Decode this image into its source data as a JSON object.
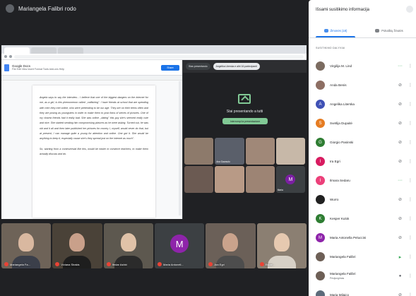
{
  "meeting": {
    "presenter_name": "Mariangela Falibri rodo"
  },
  "share": {
    "doc_title": "Google Docs",
    "doc_menu": "File  Edit  View  Insert  Format  Tools  Add-ons  Help",
    "share_label": "Share",
    "doc_paragraph_1": "Angela says to say the interview... I believe that one of the biggest dangers on the internet for me, as a girl, is this phenomenon called ,,catfishing\". I have friends at school that are spending with men they met online, who were pretending to be our age. They are on their teens often and they are posing as youngsters in order to make them to post fotos of selves of pictures. One of my closest friends had it really bad. She was online ,,dating\" this guy she's seemed really cute and nice. She started sending him compromising pictures as he were asking. Turned out, he was old and it all and then later published her pictures for money. I, myself, would never do that, but at present, I can manage quite a young for attention and online. One got it. She would be anything to keep it, especially cause she's they spread just on the internet as much\".",
    "doc_paragraph_2": "So, starting from a controversial like this, would be easier to convince teachers, to make them actually discuss and do.",
    "meet_chip_1": "Stas presentando",
    "meet_chip_2": "Angelika Literska e altri 16 partecipanti",
    "present_title": "Stai presentando a tutti",
    "present_button": "Interrompi la presentazione",
    "mini_tiles": [
      {
        "label": "",
        "bg": "#8d7a6b",
        "avatar": ""
      },
      {
        "label": "Ana Gaarsolo",
        "bg": "#5a5f6a",
        "avatar": ""
      },
      {
        "label": "",
        "bg": "#a08878",
        "avatar": ""
      },
      {
        "label": "",
        "bg": "#c7b8a8",
        "avatar": ""
      },
      {
        "label": "",
        "bg": "#6b5a52",
        "avatar": ""
      },
      {
        "label": "",
        "bg": "#b89a86",
        "avatar": ""
      },
      {
        "label": "",
        "bg": "#9d8474",
        "avatar": ""
      },
      {
        "label": "Maria",
        "bg": "#3c4043",
        "avatar": "M"
      }
    ]
  },
  "tiles": [
    {
      "name": "Mariangela Fa...",
      "bg": "#6e6358",
      "face": "#d9b8a0",
      "body": "#3b3f4a",
      "avatar": ""
    },
    {
      "name": "Viviana Sirakis",
      "bg": "#4a4238",
      "face": "#c9a08a",
      "body": "#1e1e1e",
      "avatar": ""
    },
    {
      "name": "Ifedar Ashbi",
      "bg": "#5d584f",
      "face": "#e0c2a8",
      "body": "#2b2b2b",
      "avatar": ""
    },
    {
      "name": "Maria Antonell...",
      "bg": "#3c4043",
      "face": "",
      "body": "",
      "avatar": "M"
    },
    {
      "name": "Ara Egri",
      "bg": "#6b6058",
      "face": "#caa38c",
      "body": "#4d4d4d",
      "avatar": ""
    },
    {
      "name": "Eskar...",
      "bg": "#8b7f72",
      "face": "#e6c9b0",
      "body": "#d7d0c6",
      "avatar": ""
    }
  ],
  "panel": {
    "title": "Išsami susitikimo informacija",
    "tab_people": "Žmonės (18)",
    "tab_chat": "Pokalbių žinutės",
    "section": "SUSITIKIMO DALYVIAI",
    "people": [
      {
        "name": "Virgilija M. Lind",
        "sub": "",
        "color": "#7b6b60",
        "initial": "",
        "icon": "dots"
      },
      {
        "name": "Anda Benis",
        "sub": "",
        "color": "#8d6e63",
        "initial": "",
        "icon": "mic"
      },
      {
        "name": "Angelika Literska",
        "sub": "",
        "color": "#3f51b5",
        "initial": "A",
        "icon": "mic"
      },
      {
        "name": "Svetlija Dupaitė",
        "sub": "",
        "color": "#e67c22",
        "initial": "S",
        "icon": "mic"
      },
      {
        "name": "Giorgio Pasinski",
        "sub": "",
        "color": "#2e7d32",
        "initial": "G",
        "icon": "mic"
      },
      {
        "name": "Ira Egri",
        "sub": "",
        "color": "#d81b60",
        "initial": "I",
        "icon": "mic"
      },
      {
        "name": "Ilmara Sedaru",
        "sub": "",
        "color": "#ec407a",
        "initial": "I",
        "icon": "dots"
      },
      {
        "name": "Wurro",
        "sub": "",
        "color": "#212121",
        "initial": "",
        "icon": "mic"
      },
      {
        "name": "Kesper Kulok",
        "sub": "",
        "color": "#2e7d32",
        "initial": "K",
        "icon": "mic"
      },
      {
        "name": "Maria Antonella Peluccini",
        "sub": "",
        "color": "#8e24aa",
        "initial": "M",
        "icon": "mic"
      },
      {
        "name": "Mariangela Falibri",
        "sub": "",
        "color": "#6d5f56",
        "initial": "",
        "icon": "speaking"
      },
      {
        "name": "Mariangela Falibri",
        "sub": "Prisijungimas",
        "color": "#6d5f56",
        "initial": "",
        "icon": "mic-on"
      },
      {
        "name": "Maria Milaico",
        "sub": "",
        "color": "#5d6b7a",
        "initial": "",
        "icon": "mic"
      }
    ]
  }
}
